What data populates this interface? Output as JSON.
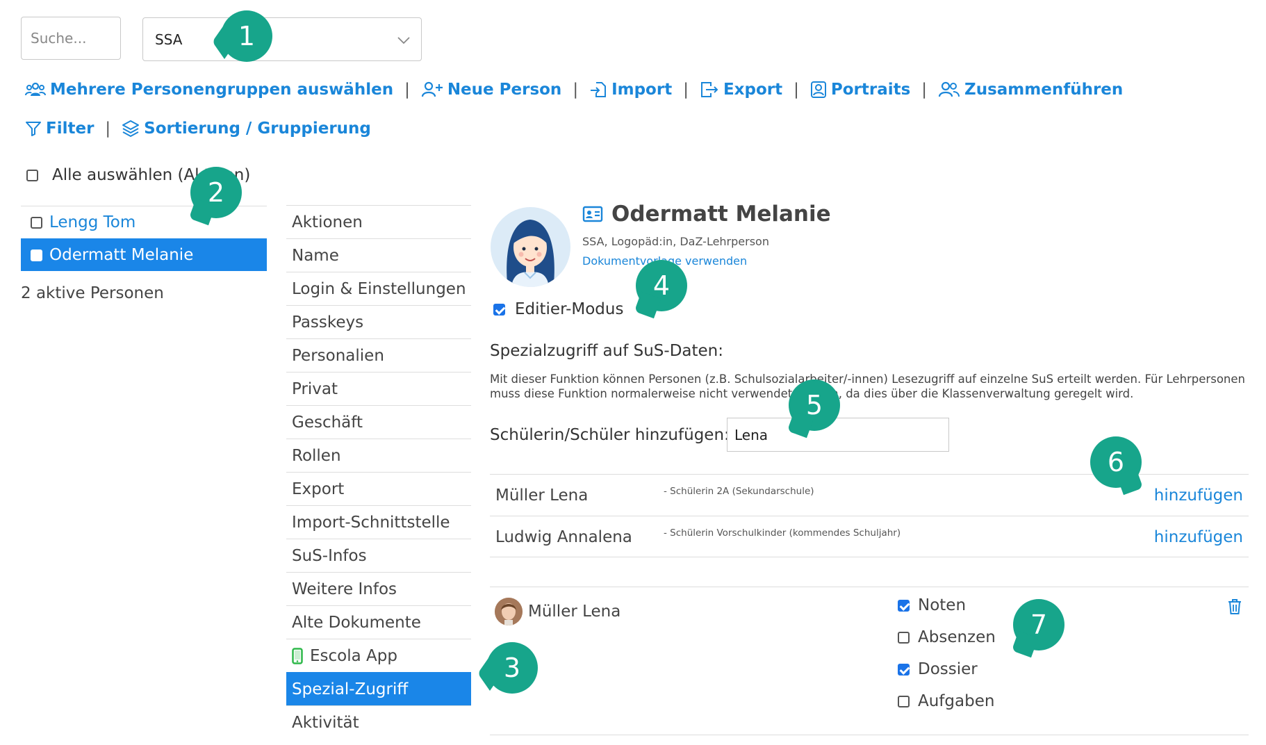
{
  "search": {
    "placeholder": "Suche..."
  },
  "group_select": {
    "value": "SSA"
  },
  "toolbar": {
    "row1": [
      {
        "label": "Mehrere Personengruppen auswählen",
        "icon": "users-icon"
      },
      {
        "label": "Neue Person",
        "icon": "user-plus-icon"
      },
      {
        "label": "Import",
        "icon": "import-icon"
      },
      {
        "label": "Export",
        "icon": "export-icon"
      },
      {
        "label": "Portraits",
        "icon": "portrait-icon"
      },
      {
        "label": "Zusammenführen",
        "icon": "merge-users-icon"
      }
    ],
    "row2": [
      {
        "label": "Filter",
        "icon": "filter-icon"
      },
      {
        "label": "Sortierung / Gruppierung",
        "icon": "layers-icon"
      }
    ]
  },
  "select_all": {
    "label": "Alle auswählen (Aktiven)"
  },
  "persons": [
    {
      "name": "Lengg Tom",
      "active": false
    },
    {
      "name": "Odermatt Melanie",
      "active": true
    }
  ],
  "persons_count": "2 aktive Personen",
  "menu": [
    "Aktionen",
    "Name",
    "Login & Einstellungen",
    "Passkeys",
    "Personalien",
    "Privat",
    "Geschäft",
    "Rollen",
    "Export",
    "Import-Schnittstelle",
    "SuS-Infos",
    "Weitere Infos",
    "Alte Dokumente",
    "Escola App",
    "Spezial-Zugriff",
    "Aktivität"
  ],
  "menu_active": "Spezial-Zugriff",
  "profile": {
    "name": "Odermatt Melanie",
    "roles": "SSA, Logopäd:in, DaZ-Lehrperson",
    "template_link": "Dokumentvorlage verwenden"
  },
  "edit_mode": {
    "label": "Editier-Modus",
    "checked": true
  },
  "special_access": {
    "heading": "Spezialzugriff auf SuS-Daten:",
    "description": "Mit dieser Funktion können Personen (z.B. Schulsozialarbeiter/-innen) Lesezugriff auf einzelne SuS erteilt werden. Für Lehrpersonen muss diese Funktion normalerweise nicht verwendet werden, da dies über die Klassenverwaltung geregelt wird.",
    "add_label": "Schülerin/Schüler hinzufügen:",
    "add_value": "Lena",
    "results": [
      {
        "name": "Müller Lena",
        "info": "- Schülerin 2A (Sekundarschule)",
        "action": "hinzufügen"
      },
      {
        "name": "Ludwig Annalena",
        "info": "- Schülerin Vorschulkinder (kommendes Schuljahr)",
        "action": "hinzufügen"
      }
    ],
    "granted": {
      "name": "Müller Lena",
      "permissions": [
        {
          "label": "Noten",
          "checked": true
        },
        {
          "label": "Absenzen",
          "checked": false
        },
        {
          "label": "Dossier",
          "checked": true
        },
        {
          "label": "Aufgaben",
          "checked": false
        }
      ]
    }
  },
  "callouts": [
    "1",
    "2",
    "3",
    "4",
    "5",
    "6",
    "7"
  ],
  "colors": {
    "accent": "#1a86e8",
    "link": "#1a86d9",
    "callout": "#17a58b"
  }
}
